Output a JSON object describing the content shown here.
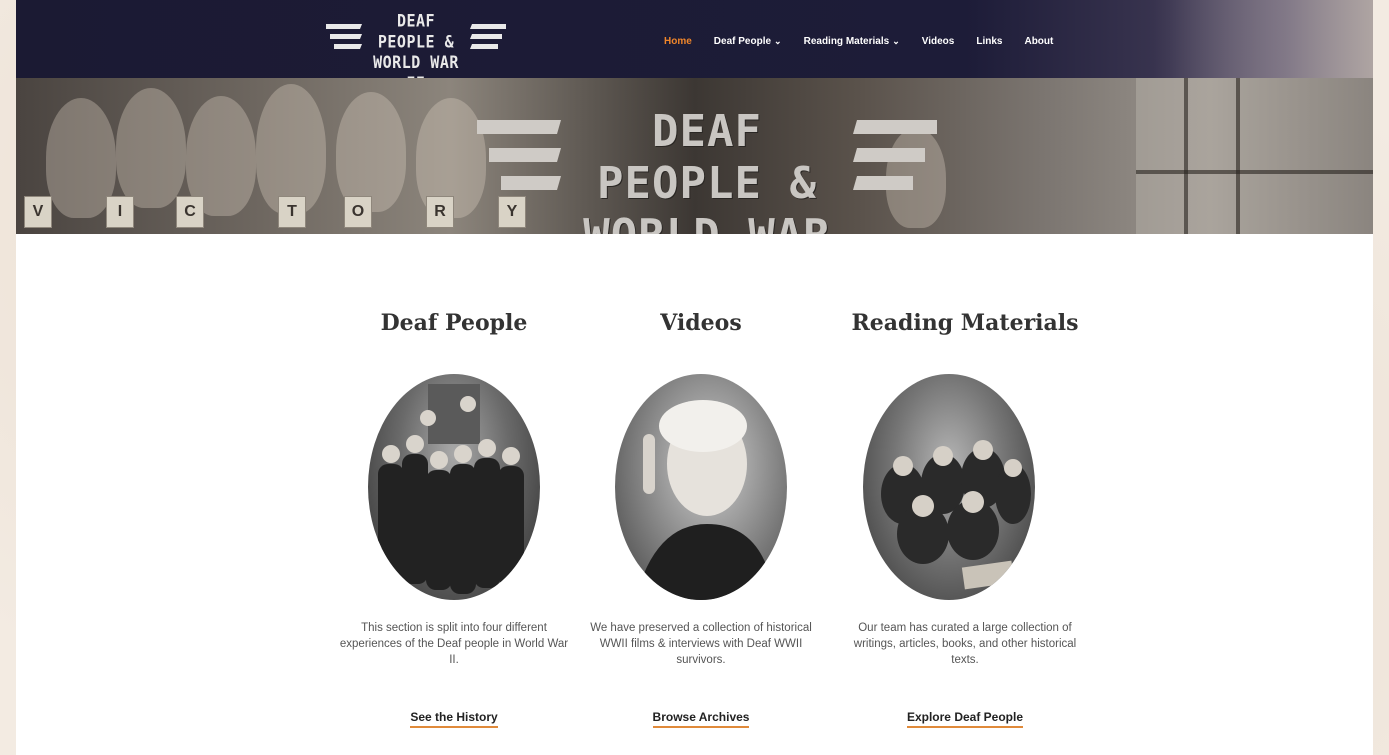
{
  "site": {
    "logo_text_line1": "DEAF PEOPLE &",
    "logo_text_line2": "WORLD WAR II"
  },
  "nav": {
    "items": [
      {
        "label": "Home",
        "active": true,
        "has_dropdown": false
      },
      {
        "label": "Deaf People",
        "active": false,
        "has_dropdown": true
      },
      {
        "label": "Reading Materials",
        "active": false,
        "has_dropdown": true
      },
      {
        "label": "Videos",
        "active": false,
        "has_dropdown": false
      },
      {
        "label": "Links",
        "active": false,
        "has_dropdown": false
      },
      {
        "label": "About",
        "active": false,
        "has_dropdown": false
      }
    ],
    "active_color": "#f0862a"
  },
  "hero": {
    "title_line1": "DEAF PEOPLE &",
    "title_line2": "WORLD WAR II",
    "letters": [
      "V",
      "I",
      "C",
      "T",
      "O",
      "R",
      "Y"
    ]
  },
  "features": [
    {
      "title": "Deaf People",
      "image": "group-photo-deaf-students",
      "description": "This section is split into four different experiences of the Deaf people in World War II.",
      "link": "See the History"
    },
    {
      "title": "Videos",
      "image": "portrait-elderly-woman-signing",
      "description": "We have preserved a collection of historical WWII films & interviews with Deaf WWII survivors.",
      "link": "Browse Archives"
    },
    {
      "title": "Reading Materials",
      "image": "group-reading-at-table",
      "description": "Our team has curated a large collection of writings, articles, books, and other historical texts.",
      "link": "Explore Deaf People"
    }
  ],
  "colors": {
    "nav_bg": "#1b1a33",
    "link_underline": "#e08a3a"
  }
}
